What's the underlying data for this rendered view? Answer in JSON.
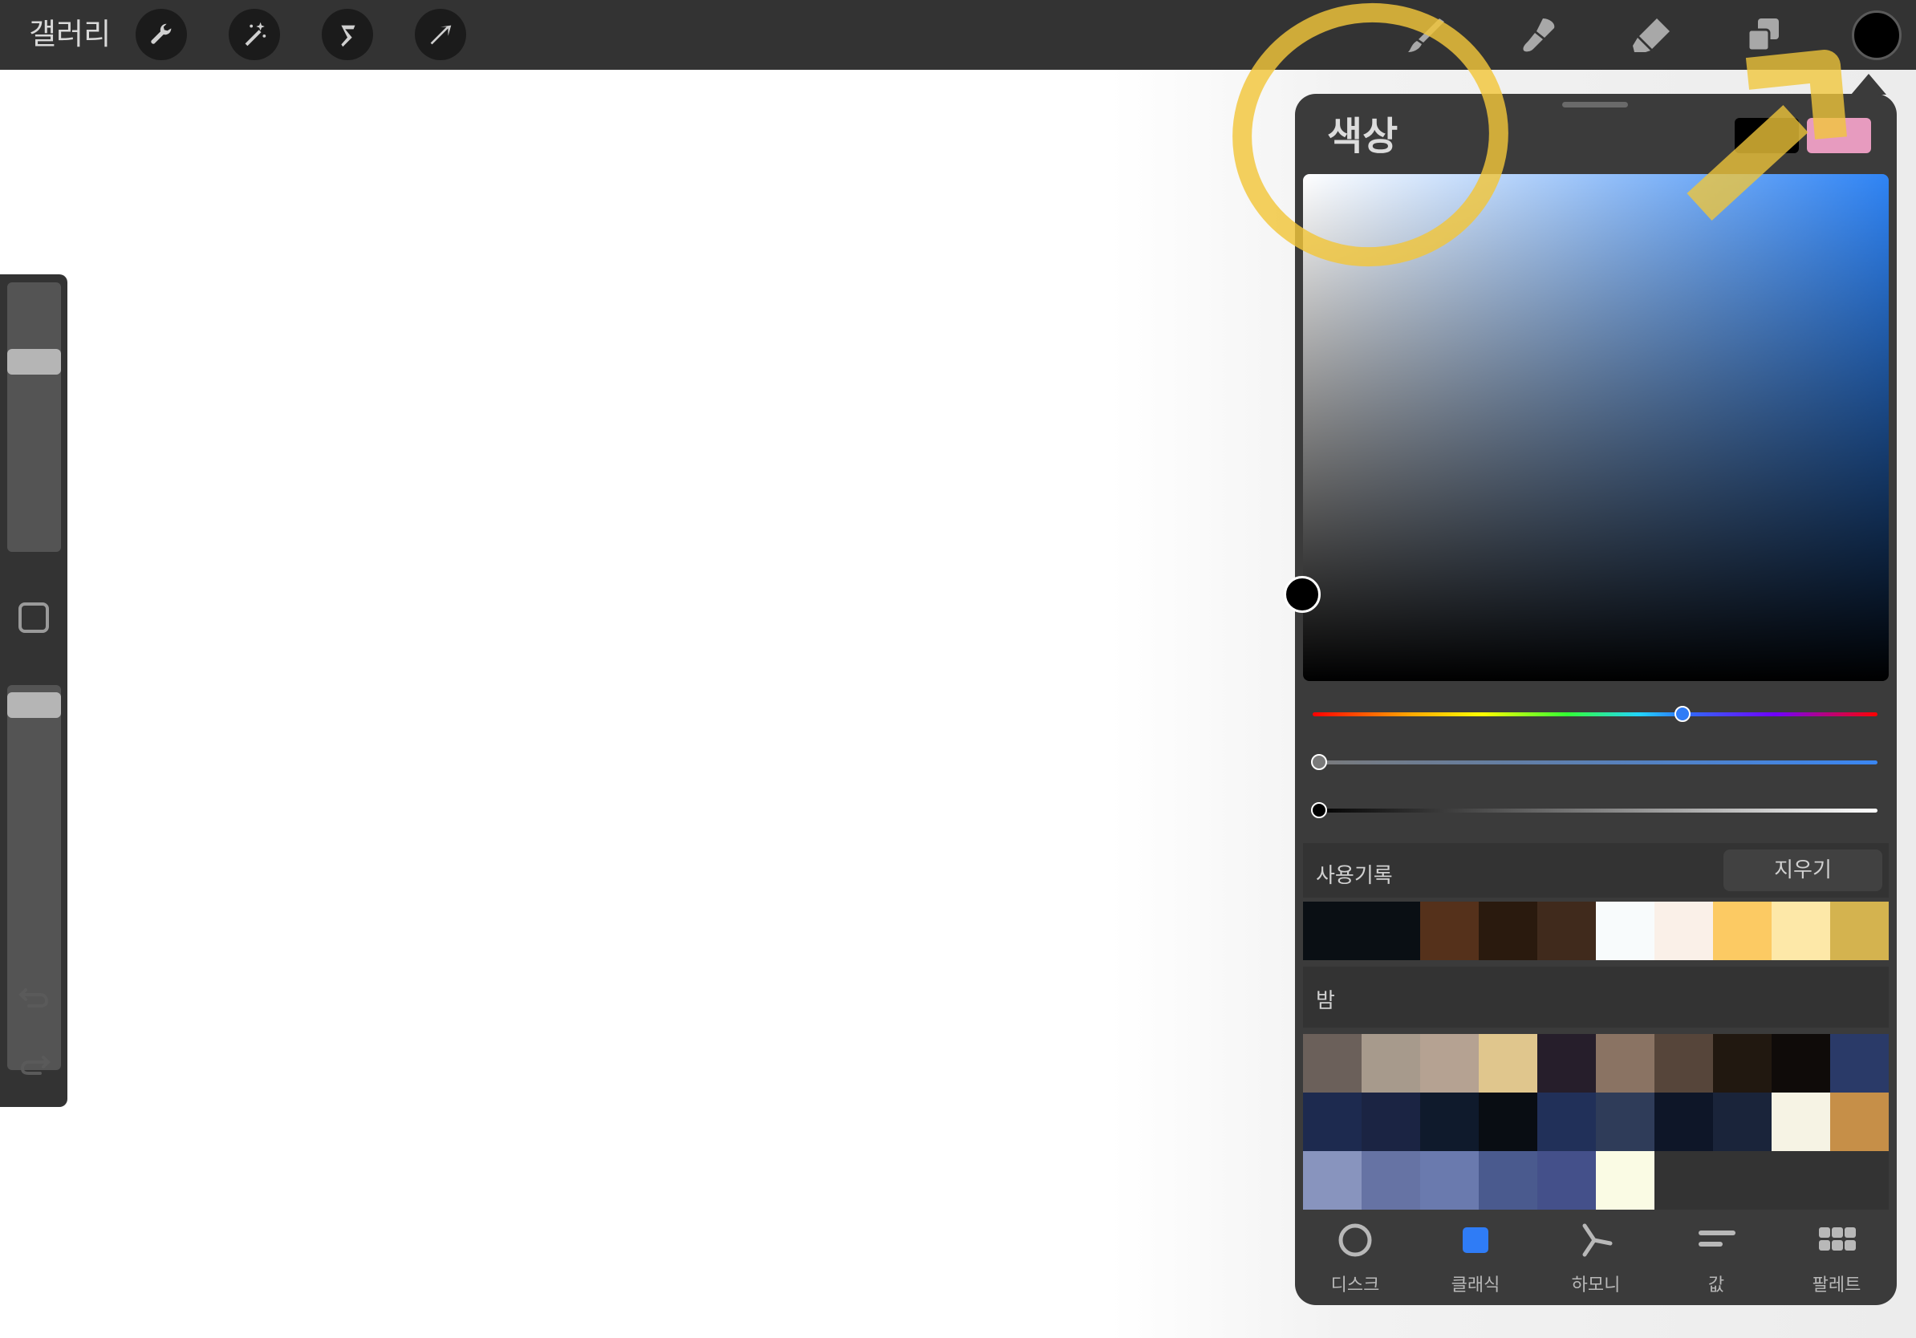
{
  "toolbar": {
    "gallery_label": "갤러리",
    "left_tools": [
      {
        "icon": "wrench-icon",
        "name": "actions"
      },
      {
        "icon": "magic-wand-icon",
        "name": "adjustments"
      },
      {
        "icon": "selection-icon",
        "name": "selection"
      },
      {
        "icon": "transform-arrow-icon",
        "name": "transform"
      }
    ],
    "right_tools": [
      {
        "icon": "brush-icon",
        "name": "brush"
      },
      {
        "icon": "smudge-icon",
        "name": "smudge"
      },
      {
        "icon": "eraser-icon",
        "name": "eraser"
      },
      {
        "icon": "layers-icon",
        "name": "layers"
      }
    ],
    "active_color": "#000000"
  },
  "sidebar": {
    "size_slider_value": 0.3,
    "opacity_slider_value": 0.02,
    "icons": [
      "modify-square-icon",
      "undo-icon",
      "redo-icon"
    ]
  },
  "color_panel": {
    "title": "색상",
    "current_color": "#000000",
    "previous_color": "#e79bbf",
    "hue_value": 0.655,
    "saturation_value": 0.0,
    "brightness_value": 0.0,
    "history": {
      "label": "사용기록",
      "clear_label": "지우기",
      "colors": [
        "#0a0f14",
        "#0a0f14",
        "#55311b",
        "#2a1a0e",
        "#402a1c",
        "#f8fbfc",
        "#faf0e8",
        "#fcca63",
        "#fde8a8",
        "#d4b34f"
      ]
    },
    "palette": {
      "label": "밤",
      "rows": [
        [
          "#6b605a",
          "#a79a8c",
          "#b5a292",
          "#e0c68d",
          "#261e2b",
          "#8a7363",
          "#56453a",
          "#211810",
          "#0f0b09",
          "#2a3a68"
        ],
        [
          "#1d2a4f",
          "#1b2443",
          "#0f1a2c",
          "#090d13",
          "#213059",
          "#2f3c59",
          "#0e1628",
          "#1a243a",
          "#f6f3e4",
          "#c68f48"
        ],
        [
          "#8894be",
          "#6673a4",
          "#6a7aae",
          "#4a5a8e",
          "#44508a",
          "#fafbe4",
          "#333333",
          "#333333",
          "#333333",
          "#333333"
        ]
      ]
    },
    "tabs": [
      {
        "icon": "disc-icon",
        "label": "디스크"
      },
      {
        "icon": "classic-square-icon",
        "label": "클래식"
      },
      {
        "icon": "harmony-icon",
        "label": "하모니"
      },
      {
        "icon": "value-bars-icon",
        "label": "값"
      },
      {
        "icon": "palette-grid-icon",
        "label": "팔레트"
      }
    ],
    "active_tab": "클래식",
    "accent": "#2f7cf6"
  }
}
